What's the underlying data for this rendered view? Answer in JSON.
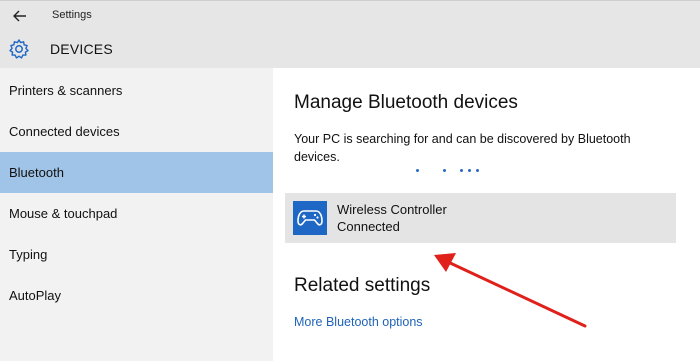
{
  "titlebar": {
    "title": "Settings",
    "back_icon": "back-arrow-icon"
  },
  "header": {
    "title": "DEVICES",
    "icon": "gear-icon"
  },
  "sidebar": {
    "items": [
      {
        "label": "Printers & scanners"
      },
      {
        "label": "Connected devices"
      },
      {
        "label": "Bluetooth",
        "active": true
      },
      {
        "label": "Mouse & touchpad"
      },
      {
        "label": "Typing"
      },
      {
        "label": "AutoPlay"
      }
    ]
  },
  "main": {
    "title": "Manage Bluetooth devices",
    "description": "Your PC is searching for and can be discovered by Bluetooth devices.",
    "device": {
      "name": "Wireless Controller",
      "status": "Connected",
      "icon": "gamepad-icon"
    },
    "related_title": "Related settings",
    "link": "More Bluetooth options"
  },
  "colors": {
    "accent": "#1e67c4",
    "selected_nav": "#9fc4e7",
    "link": "#1f63b8",
    "annotation": "#e0201b"
  }
}
